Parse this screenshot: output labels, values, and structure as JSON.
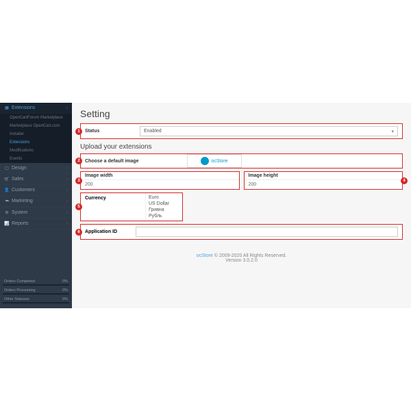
{
  "sidebar": {
    "extensions": "Extensions",
    "subs": [
      "OpenCartForum Marketplace",
      "Marketplace OpenCart.com",
      "Installer",
      "Extensions",
      "Modifications",
      "Events"
    ],
    "design": "Design",
    "sales": "Sales",
    "customers": "Customers",
    "marketing": "Marketing",
    "system": "System",
    "reports": "Reports",
    "stats": [
      {
        "label": "Orders Completed",
        "val": "0%"
      },
      {
        "label": "Orders Processing",
        "val": "0%"
      },
      {
        "label": "Other Statuses",
        "val": "0%"
      }
    ]
  },
  "page": {
    "title": "Setting",
    "status_label": "Status",
    "status_value": "Enabled",
    "upload_title": "Upload your extensions",
    "default_img_label": "Choose a default image",
    "logo_text": "ocStore",
    "width_label": "Image width",
    "width_value": "200",
    "height_label": "Image height",
    "height_value": "200",
    "currency_label": "Currency",
    "currencies": [
      "Euro",
      "US Dollar",
      "Гривна",
      "Рубль"
    ],
    "app_id_label": "Application ID",
    "markers": {
      "1": "1",
      "2": "2",
      "3": "3",
      "4": "4",
      "5": "5",
      "6": "6"
    }
  },
  "footer": {
    "link": "ocStore",
    "copy": " © 2009-2020 All Rights Reserved.",
    "ver": "Version 3.0.2.0"
  }
}
